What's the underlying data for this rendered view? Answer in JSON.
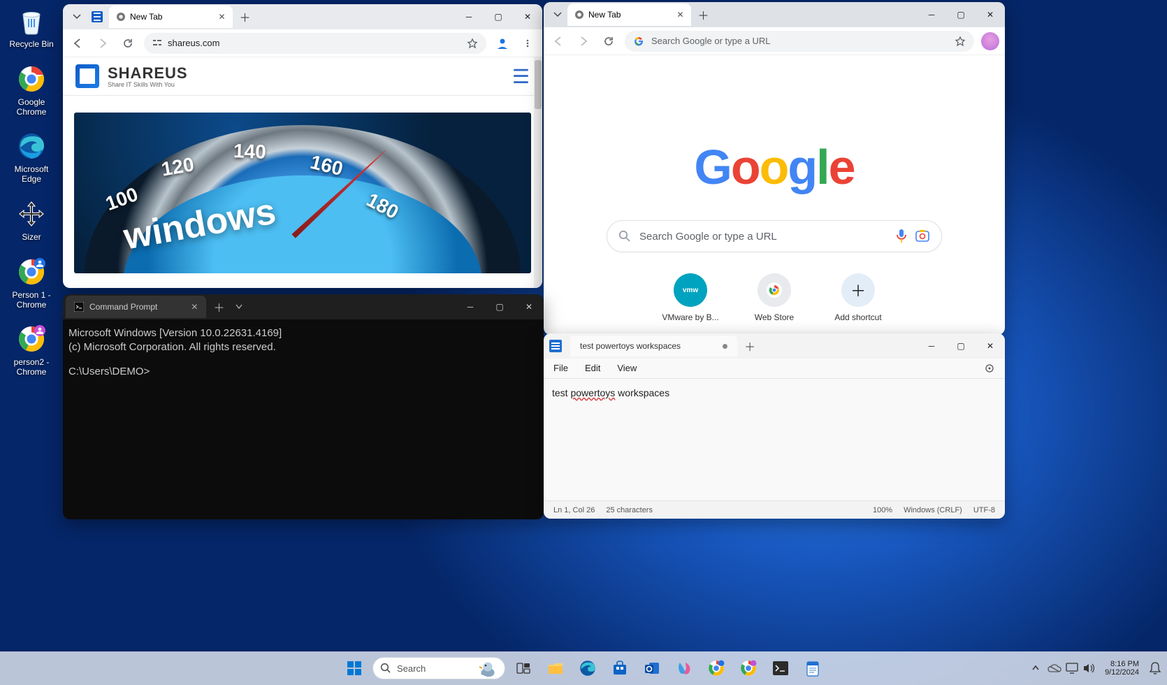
{
  "desktop": {
    "icons": [
      {
        "label": "Recycle Bin"
      },
      {
        "label": "Google Chrome"
      },
      {
        "label": "Microsoft Edge"
      },
      {
        "label": "Sizer"
      },
      {
        "label": "Person 1 - Chrome"
      },
      {
        "label": "person2 - Chrome"
      }
    ]
  },
  "chrome1": {
    "tab_title": "New Tab",
    "url": "shareus.com",
    "site_name": "SHAREUS",
    "site_tagline": "Share IT Skills With You",
    "hero_word": "windows",
    "dial_numbers": [
      "100",
      "120",
      "140",
      "160",
      "180"
    ]
  },
  "chrome2": {
    "tab_title": "New Tab",
    "omnibox_placeholder": "Search Google or type a URL",
    "search_placeholder": "Search Google or type a URL",
    "shortcuts": [
      {
        "label": "VMware by B..."
      },
      {
        "label": "Web Store"
      },
      {
        "label": "Add shortcut"
      }
    ]
  },
  "cmd": {
    "tab_title": "Command Prompt",
    "line1": "Microsoft Windows [Version 10.0.22631.4169]",
    "line2": "(c) Microsoft Corporation. All rights reserved.",
    "prompt": "C:\\Users\\DEMO>"
  },
  "notepad": {
    "tab_title": "test powertoys workspaces",
    "menus": {
      "file": "File",
      "edit": "Edit",
      "view": "View"
    },
    "content_pre": "test ",
    "content_sp": "powertoys",
    "content_post": " workspaces",
    "status": {
      "pos": "Ln 1, Col 26",
      "chars": "25 characters",
      "zoom": "100%",
      "eol": "Windows (CRLF)",
      "enc": "UTF-8"
    }
  },
  "taskbar": {
    "search": "Search",
    "time": "8:16 PM",
    "date": "9/12/2024"
  }
}
